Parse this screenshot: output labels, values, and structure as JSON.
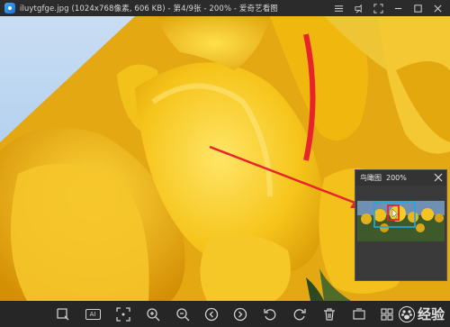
{
  "window": {
    "title": "iluytgfge.jpg (1024x768像素, 606 KB) - 第4/9张 - 200% - 爱奇艺看图"
  },
  "window_controls": [
    {
      "name": "menu-icon"
    },
    {
      "name": "pin-icon"
    },
    {
      "name": "fullscreen-icon"
    },
    {
      "name": "minimize-icon"
    },
    {
      "name": "maximize-icon"
    },
    {
      "name": "close-icon"
    }
  ],
  "navigator": {
    "title": "鸟瞰图",
    "zoom": "200%"
  },
  "toolbar": {
    "ai_label": "AI",
    "buttons": [
      "crop-icon",
      "ai-icon",
      "fit-screen-icon",
      "zoom-in-icon",
      "zoom-out-icon",
      "previous-icon",
      "next-icon",
      "rotate-left-icon",
      "rotate-right-icon",
      "delete-icon",
      "more-icon",
      "grid-icon"
    ]
  },
  "watermark": {
    "text": "经验"
  },
  "colors": {
    "titlebar": "#2b2b2b",
    "toolbar": "#262626",
    "arrow": "#e8232a",
    "petal": "#f2c21a"
  }
}
